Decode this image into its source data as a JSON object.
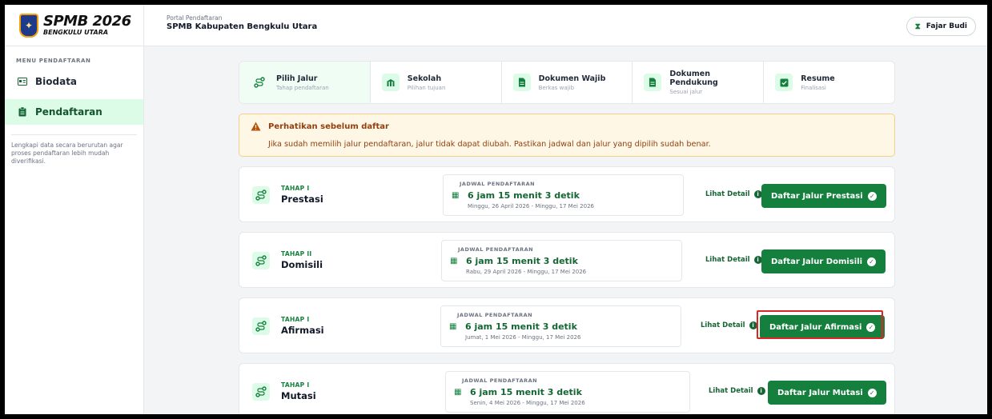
{
  "brand": {
    "title": "SPMB 2026",
    "subtitle": "BENGKULU UTARA"
  },
  "sidebar": {
    "heading": "MENU PENDAFTARAN",
    "items": [
      {
        "label": "Biodata",
        "icon": "id-card-icon",
        "active": false
      },
      {
        "label": "Pendaftaran",
        "icon": "clipboard-icon",
        "active": true
      }
    ],
    "note": "Lengkapi data secara berurutan agar proses pendaftaran lebih mudah diverifikasi."
  },
  "topbar": {
    "small": "Portal Pendaftaran",
    "title": "SPMB Kabupaten Bengkulu Utara",
    "user": "Fajar Budi"
  },
  "steps": [
    {
      "title": "Pilih Jalur",
      "sub": "Tahap pendaftaran",
      "icon": "route-icon",
      "active": true
    },
    {
      "title": "Sekolah",
      "sub": "Pilihan tujuan",
      "icon": "school-icon",
      "active": false
    },
    {
      "title": "Dokumen Wajib",
      "sub": "Berkas wajib",
      "icon": "document-icon",
      "active": false
    },
    {
      "title": "Dokumen Pendukung",
      "sub": "Sesuai jalur",
      "icon": "document-icon",
      "active": false
    },
    {
      "title": "Resume",
      "sub": "Finalisasi",
      "icon": "check-square-icon",
      "active": false
    }
  ],
  "warning": {
    "title": "Perhatikan sebelum daftar",
    "text": "Jika sudah memilih jalur pendaftaran, jalur tidak dapat diubah. Pastikan jadwal dan jalur yang dipilih sudah benar."
  },
  "schedule_label": "JADWAL PENDAFTARAN",
  "detail_label": "Lihat Detail",
  "routes": [
    {
      "stage": "TAHAP I",
      "name": "Prestasi",
      "countdown": "6 jam 15 menit 3 detik",
      "dates": "Minggu, 26 April 2026 - Minggu, 17 Mei 2026",
      "button": "Daftar Jalur Prestasi"
    },
    {
      "stage": "TAHAP II",
      "name": "Domisili",
      "countdown": "6 jam 15 menit 3 detik",
      "dates": "Rabu, 29 April 2026 - Minggu, 17 Mei 2026",
      "button": "Daftar Jalur Domisili"
    },
    {
      "stage": "TAHAP I",
      "name": "Afirmasi",
      "countdown": "6 jam 15 menit 3 detik",
      "dates": "Jumat, 1 Mei 2026 - Minggu, 17 Mei 2026",
      "button": "Daftar Jalur Afirmasi"
    },
    {
      "stage": "TAHAP I",
      "name": "Mutasi",
      "countdown": "6 jam 15 menit 3 detik",
      "dates": "Senin, 4 Mei 2026 - Minggu, 17 Mei 2026",
      "button": "Daftar Jalur Mutasi"
    }
  ],
  "colors": {
    "accent": "#15803d",
    "highlight": "#dc2626",
    "warning_bg": "#fff7e6"
  }
}
